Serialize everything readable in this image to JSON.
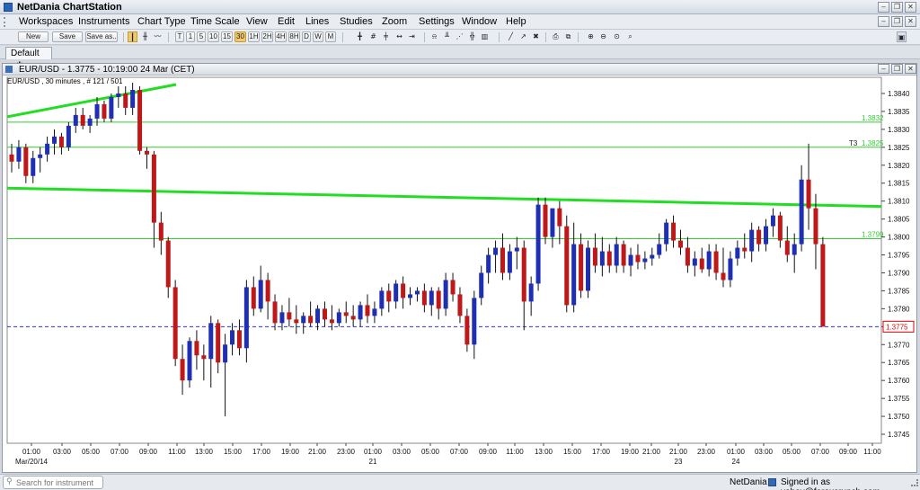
{
  "app": {
    "title": "NetDania ChartStation"
  },
  "menu": [
    "Workspaces",
    "Instruments",
    "Chart Type",
    "Time Scale",
    "View",
    "Edit",
    "Lines",
    "Studies",
    "Zoom",
    "Settings",
    "Window",
    "Help"
  ],
  "toolbar": {
    "new_label": "New",
    "save_label": "Save",
    "save_as_label": "Save as..",
    "timescale": [
      "T",
      "1",
      "5",
      "10",
      "15",
      "30",
      "1H",
      "2H",
      "4H",
      "8H",
      "D",
      "W",
      "M"
    ],
    "active_timescale": "30"
  },
  "workspace_tab": {
    "label": "Default",
    "close_glyph": "✱"
  },
  "chart_window": {
    "title": "EUR/USD - 1.3775 - 10:19:00  24 Mar (CET)",
    "subtitle": "EUR/USD , 30 minutes , # 121 / 501"
  },
  "chart_data": {
    "type": "candlestick",
    "instrument": "EUR/USD",
    "interval": "30 minutes",
    "y_ticks": [
      "1.3840",
      "1.3835",
      "1.3830",
      "1.3825",
      "1.3820",
      "1.3815",
      "1.3810",
      "1.3805",
      "1.3800",
      "1.3795",
      "1.3790",
      "1.3785",
      "1.3780",
      "1.3775",
      "1.3770",
      "1.3765",
      "1.3760",
      "1.3755",
      "1.3750",
      "1.3745"
    ],
    "ylim": [
      1.37425,
      1.38445
    ],
    "x_labels": [
      "01:00",
      "03:00",
      "05:00",
      "07:00",
      "09:00",
      "11:00",
      "13:00",
      "15:00",
      "17:00",
      "19:00",
      "21:00",
      "23:00",
      "01:00",
      "03:00",
      "05:00",
      "07:00",
      "09:00",
      "11:00",
      "13:00",
      "15:00",
      "17:00",
      "19:00",
      "21:00",
      "21:00",
      "23:00",
      "01:00",
      "03:00",
      "05:00",
      "07:00",
      "09:00",
      "11:00"
    ],
    "date_labels": [
      "Mar/20/14",
      "21",
      "23",
      "24"
    ],
    "horizontal_lines": [
      {
        "price": 1.3832,
        "label": "1.3832",
        "color": "#33cc33"
      },
      {
        "price": 1.3825,
        "label": "1.3825",
        "tag": "T3",
        "color": "#33cc33"
      },
      {
        "price": 1.37995,
        "label": "1.3799",
        "color": "#33cc33"
      }
    ],
    "current_price": {
      "price": 1.3775,
      "label": "1.3775",
      "color": "#3333cc"
    },
    "trendlines_color": "#22dd22",
    "up_color": "#1e2fb4",
    "down_color": "#c01818",
    "candles": [
      [
        1.3823,
        1.3826,
        1.3818,
        1.3821
      ],
      [
        1.3821,
        1.3827,
        1.3819,
        1.3825
      ],
      [
        1.3825,
        1.3826,
        1.3815,
        1.3817
      ],
      [
        1.3817,
        1.3824,
        1.3815,
        1.3822
      ],
      [
        1.3822,
        1.3825,
        1.3818,
        1.3823
      ],
      [
        1.3823,
        1.3828,
        1.3821,
        1.3826
      ],
      [
        1.3826,
        1.383,
        1.3823,
        1.3828
      ],
      [
        1.3828,
        1.3829,
        1.3823,
        1.3825
      ],
      [
        1.3825,
        1.3832,
        1.3824,
        1.3831
      ],
      [
        1.3831,
        1.3836,
        1.3829,
        1.3834
      ],
      [
        1.3834,
        1.3836,
        1.383,
        1.3831
      ],
      [
        1.3831,
        1.3834,
        1.3829,
        1.3833
      ],
      [
        1.3833,
        1.3839,
        1.3831,
        1.3837
      ],
      [
        1.3837,
        1.3838,
        1.3832,
        1.3833
      ],
      [
        1.3833,
        1.384,
        1.3832,
        1.3839
      ],
      [
        1.3839,
        1.3842,
        1.3836,
        1.384
      ],
      [
        1.384,
        1.3842,
        1.3834,
        1.3836
      ],
      [
        1.3836,
        1.3843,
        1.3834,
        1.3841
      ],
      [
        1.3841,
        1.3842,
        1.3823,
        1.3824
      ],
      [
        1.3824,
        1.3825,
        1.3819,
        1.3823
      ],
      [
        1.3823,
        1.3824,
        1.3797,
        1.3804
      ],
      [
        1.3804,
        1.3807,
        1.3795,
        1.3799
      ],
      [
        1.3799,
        1.38,
        1.3783,
        1.3786
      ],
      [
        1.3786,
        1.3788,
        1.3764,
        1.3766
      ],
      [
        1.3766,
        1.377,
        1.3756,
        1.376
      ],
      [
        1.376,
        1.3772,
        1.3758,
        1.3771
      ],
      [
        1.3771,
        1.3774,
        1.3763,
        1.3767
      ],
      [
        1.3767,
        1.377,
        1.376,
        1.3766
      ],
      [
        1.3766,
        1.3778,
        1.3758,
        1.3776
      ],
      [
        1.3776,
        1.3777,
        1.3762,
        1.3765
      ],
      [
        1.3765,
        1.3773,
        1.375,
        1.377
      ],
      [
        1.377,
        1.3776,
        1.3767,
        1.3774
      ],
      [
        1.3774,
        1.3777,
        1.3767,
        1.3769
      ],
      [
        1.3769,
        1.3788,
        1.3765,
        1.3786
      ],
      [
        1.3786,
        1.3789,
        1.3778,
        1.378
      ],
      [
        1.378,
        1.3792,
        1.3779,
        1.3788
      ],
      [
        1.3788,
        1.379,
        1.3777,
        1.3782
      ],
      [
        1.3782,
        1.3784,
        1.3774,
        1.3776
      ],
      [
        1.3776,
        1.3781,
        1.3774,
        1.3779
      ],
      [
        1.3779,
        1.3783,
        1.3775,
        1.3777
      ],
      [
        1.3777,
        1.3781,
        1.3773,
        1.3776
      ],
      [
        1.3776,
        1.3779,
        1.3773,
        1.3778
      ],
      [
        1.3778,
        1.3782,
        1.3775,
        1.3776
      ],
      [
        1.3776,
        1.3781,
        1.3774,
        1.378
      ],
      [
        1.378,
        1.3782,
        1.3775,
        1.3777
      ],
      [
        1.3777,
        1.3781,
        1.3774,
        1.3776
      ],
      [
        1.3776,
        1.378,
        1.3775,
        1.3779
      ],
      [
        1.3779,
        1.3782,
        1.3776,
        1.3778
      ],
      [
        1.3778,
        1.3781,
        1.3775,
        1.3777
      ],
      [
        1.3777,
        1.3782,
        1.3775,
        1.3781
      ],
      [
        1.3781,
        1.3784,
        1.3776,
        1.3778
      ],
      [
        1.3778,
        1.3782,
        1.3776,
        1.378
      ],
      [
        1.378,
        1.3786,
        1.3778,
        1.3785
      ],
      [
        1.3785,
        1.3787,
        1.3779,
        1.3782
      ],
      [
        1.3782,
        1.3788,
        1.378,
        1.3787
      ],
      [
        1.3787,
        1.3789,
        1.378,
        1.3783
      ],
      [
        1.3783,
        1.3786,
        1.3781,
        1.3784
      ],
      [
        1.3784,
        1.3786,
        1.3782,
        1.3785
      ],
      [
        1.3785,
        1.3787,
        1.3779,
        1.3781
      ],
      [
        1.3781,
        1.3786,
        1.3778,
        1.3785
      ],
      [
        1.3785,
        1.3786,
        1.3777,
        1.378
      ],
      [
        1.378,
        1.379,
        1.3778,
        1.3788
      ],
      [
        1.3788,
        1.379,
        1.3782,
        1.3784
      ],
      [
        1.3784,
        1.3786,
        1.3776,
        1.3778
      ],
      [
        1.3778,
        1.378,
        1.3768,
        1.377
      ],
      [
        1.377,
        1.3785,
        1.3766,
        1.3783
      ],
      [
        1.3783,
        1.3792,
        1.3781,
        1.379
      ],
      [
        1.379,
        1.3797,
        1.3787,
        1.3795
      ],
      [
        1.3795,
        1.3799,
        1.379,
        1.3797
      ],
      [
        1.3797,
        1.3801,
        1.3788,
        1.379
      ],
      [
        1.379,
        1.3798,
        1.3788,
        1.3796
      ],
      [
        1.3796,
        1.38,
        1.3791,
        1.3797
      ],
      [
        1.3797,
        1.3799,
        1.3774,
        1.3782
      ],
      [
        1.3782,
        1.3789,
        1.3778,
        1.3787
      ],
      [
        1.3787,
        1.3811,
        1.3785,
        1.3809
      ],
      [
        1.3809,
        1.3811,
        1.3798,
        1.38
      ],
      [
        1.38,
        1.3807,
        1.3797,
        1.3808
      ],
      [
        1.3808,
        1.381,
        1.3798,
        1.3803
      ],
      [
        1.3803,
        1.3806,
        1.3779,
        1.3781
      ],
      [
        1.3781,
        1.3804,
        1.3779,
        1.3798
      ],
      [
        1.3798,
        1.3801,
        1.3783,
        1.3785
      ],
      [
        1.3785,
        1.3799,
        1.3783,
        1.3797
      ],
      [
        1.3797,
        1.3801,
        1.379,
        1.3792
      ],
      [
        1.3792,
        1.38,
        1.3789,
        1.3796
      ],
      [
        1.3796,
        1.3798,
        1.379,
        1.3792
      ],
      [
        1.3792,
        1.38,
        1.379,
        1.3798
      ],
      [
        1.3798,
        1.3799,
        1.379,
        1.3792
      ],
      [
        1.3792,
        1.3797,
        1.3789,
        1.3795
      ],
      [
        1.3795,
        1.3798,
        1.3791,
        1.3793
      ],
      [
        1.3793,
        1.3796,
        1.3791,
        1.3794
      ],
      [
        1.3794,
        1.3797,
        1.3792,
        1.3795
      ],
      [
        1.3795,
        1.3801,
        1.3794,
        1.3798
      ],
      [
        1.3798,
        1.3805,
        1.3796,
        1.3804
      ],
      [
        1.3804,
        1.3806,
        1.3797,
        1.3799
      ],
      [
        1.3799,
        1.3802,
        1.3795,
        1.3797
      ],
      [
        1.3797,
        1.38,
        1.379,
        1.3792
      ],
      [
        1.3792,
        1.3796,
        1.3789,
        1.3794
      ],
      [
        1.3794,
        1.3797,
        1.379,
        1.3791
      ],
      [
        1.3791,
        1.3798,
        1.3789,
        1.3796
      ],
      [
        1.3796,
        1.3798,
        1.3788,
        1.379
      ],
      [
        1.379,
        1.3797,
        1.3786,
        1.3788
      ],
      [
        1.3788,
        1.3796,
        1.3786,
        1.3794
      ],
      [
        1.3794,
        1.3799,
        1.3792,
        1.3797
      ],
      [
        1.3797,
        1.3801,
        1.3794,
        1.3796
      ],
      [
        1.3796,
        1.3804,
        1.3793,
        1.3802
      ],
      [
        1.3802,
        1.3803,
        1.3796,
        1.3798
      ],
      [
        1.3798,
        1.3805,
        1.3796,
        1.3803
      ],
      [
        1.3803,
        1.3808,
        1.38,
        1.3806
      ],
      [
        1.3806,
        1.3807,
        1.3797,
        1.3799
      ],
      [
        1.3799,
        1.3803,
        1.3793,
        1.3795
      ],
      [
        1.3795,
        1.3801,
        1.379,
        1.3798
      ],
      [
        1.3798,
        1.382,
        1.3796,
        1.3816
      ],
      [
        1.3816,
        1.3826,
        1.3802,
        1.3808
      ],
      [
        1.3808,
        1.3812,
        1.3791,
        1.3798
      ],
      [
        1.3798,
        1.38,
        1.3775,
        1.3775
      ]
    ]
  },
  "statusbar": {
    "search_placeholder": "Search for instrument",
    "brand": "NetDania",
    "signed_in": "Signed in as yohay@forexcrunch.com"
  }
}
